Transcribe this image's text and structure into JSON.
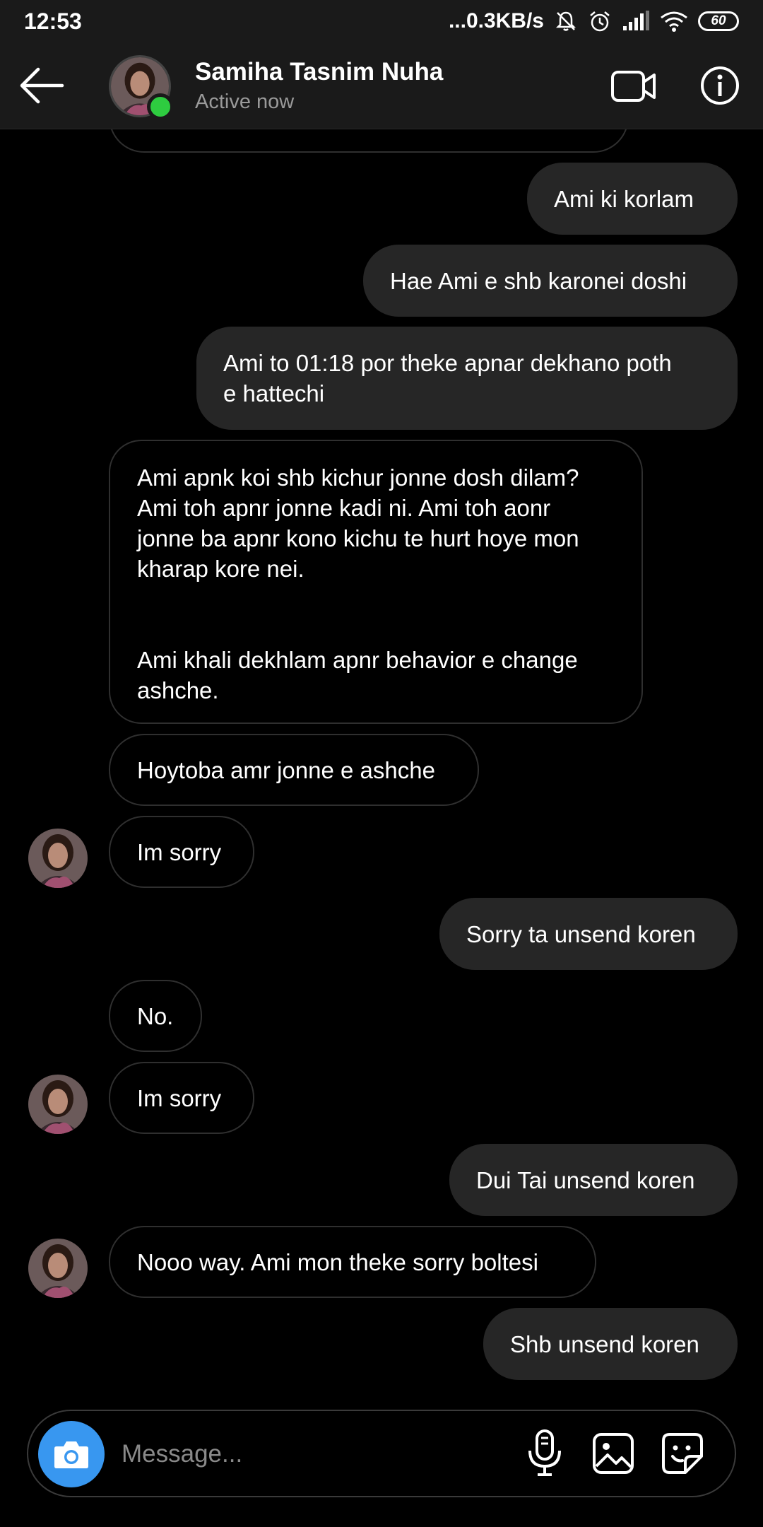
{
  "status_bar": {
    "time": "12:53",
    "network_speed": "...0.3KB/s",
    "battery": "60",
    "icons": [
      "mute-bell-icon",
      "alarm-icon",
      "signal-icon",
      "wifi-icon",
      "battery-icon"
    ]
  },
  "header": {
    "name": "Samiha Tasnim Nuha",
    "status": "Active now",
    "online_color": "#2ecc40"
  },
  "messages": [
    {
      "sender": "me",
      "text": "Ami ki korlam"
    },
    {
      "sender": "me",
      "text": "Hae Ami e shb karonei doshi"
    },
    {
      "sender": "me",
      "text": "Ami to 01:18 por theke apnar dekhano poth\ne hattechi"
    },
    {
      "sender": "them",
      "text": "Ami apnk koi shb kichur jonne dosh dilam?\nAmi toh apnr jonne kadi ni. Ami toh aonr\njonne ba apnr kono kichu te hurt hoye mon\nkharap kore nei.\n\n\nAmi khali dekhlam apnr behavior e change\nashche."
    },
    {
      "sender": "them",
      "text": "Hoytoba amr jonne e ashche"
    },
    {
      "sender": "them",
      "text": "Im sorry"
    },
    {
      "sender": "me",
      "text": "Sorry ta unsend koren"
    },
    {
      "sender": "them",
      "text": "No."
    },
    {
      "sender": "them",
      "text": "Im sorry"
    },
    {
      "sender": "me",
      "text": "Dui Tai unsend koren"
    },
    {
      "sender": "them",
      "text": "Nooo way. Ami mon theke sorry boltesi"
    },
    {
      "sender": "me",
      "text": "Shb unsend koren"
    }
  ],
  "composer": {
    "placeholder": "Message...",
    "camera_color": "#3897f0"
  }
}
